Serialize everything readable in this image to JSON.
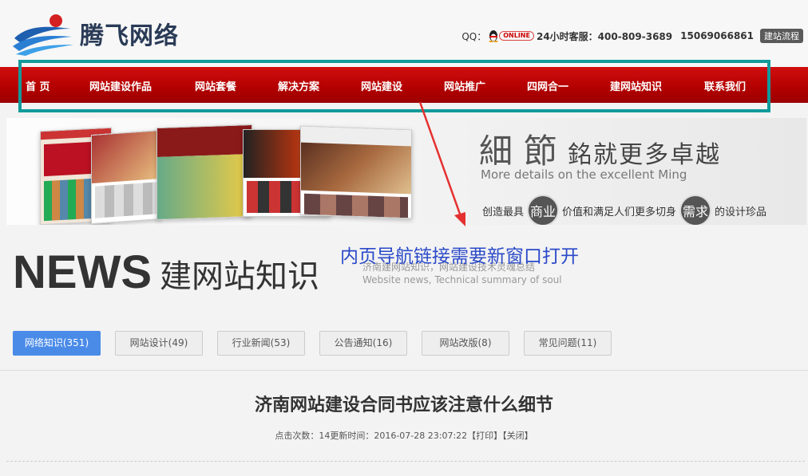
{
  "header": {
    "logo_text": "腾飞网络",
    "qq_label": "QQ：",
    "qq_status": "ONLINE",
    "hotline": "24小时客服：400-809-3689",
    "phone2": "15069066861",
    "flow_button": "建站流程"
  },
  "nav": {
    "items": [
      "首 页",
      "网站建设作品",
      "网站套餐",
      "解决方案",
      "网站建设",
      "网站推广",
      "四网合一",
      "建网站知识",
      "联系我们"
    ]
  },
  "banner": {
    "slogan_char1": "細",
    "slogan_char2": "節",
    "slogan_rest": "銘就更多卓越",
    "slogan_en": "More details on the excellent Ming",
    "slogan_small_1": "创造最具",
    "slogan_circle_1": "商业",
    "slogan_small_2": "价值和满足人们更多切身",
    "slogan_circle_2": "需求",
    "slogan_small_3": "的设计珍品"
  },
  "section": {
    "news_big": "NEWS",
    "news_cn": "建网站知识",
    "sub_cn": "济南建网站知识，网站建设技术灵魂总结",
    "sub_en": "Website news, Technical summary of soul"
  },
  "annotation": {
    "text": "内页导航链接需要新窗口打开",
    "color": "#2a49c8",
    "box_color": "#129a9a",
    "arrow_color": "#e53030"
  },
  "tabs": [
    {
      "label": "网络知识(351)",
      "active": true
    },
    {
      "label": "网站设计(49)",
      "active": false
    },
    {
      "label": "行业新闻(53)",
      "active": false
    },
    {
      "label": "公告通知(16)",
      "active": false
    },
    {
      "label": "网站改版(8)",
      "active": false
    },
    {
      "label": "常见问题(11)",
      "active": false
    }
  ],
  "article": {
    "title": "济南网站建设合同书应该注意什么细节",
    "meta": "点击次数：14更新时间：2016-07-28 23:07:22【打印】【关闭】"
  }
}
